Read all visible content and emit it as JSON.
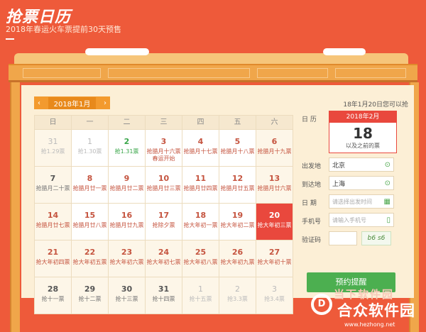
{
  "page": {
    "title": "抢票日历",
    "subtitle": "2018年春运火车票提前30天预售"
  },
  "calendar": {
    "prev": "‹",
    "next": "›",
    "month_label": "2018年1月",
    "weekdays": [
      "日",
      "一",
      "二",
      "三",
      "四",
      "五",
      "六"
    ],
    "rows": [
      [
        {
          "d": "31",
          "n": "抢1.29票",
          "s": "g"
        },
        {
          "d": "1",
          "n": "抢1.30票",
          "s": "gw"
        },
        {
          "d": "2",
          "n": "抢1.31票",
          "s": "grw"
        },
        {
          "d": "3",
          "n": "抢腊月十六票 春运开始",
          "s": "w"
        },
        {
          "d": "4",
          "n": "抢腊月十七票",
          "s": "w"
        },
        {
          "d": "5",
          "n": "抢腊月十八票",
          "s": "w"
        },
        {
          "d": "6",
          "n": "抢腊月十九票",
          "s": ""
        }
      ],
      [
        {
          "d": "7",
          "n": "抢腊月二十票",
          "s": "dk"
        },
        {
          "d": "8",
          "n": "抢腊月廿一票",
          "s": "w"
        },
        {
          "d": "9",
          "n": "抢腊月廿二票",
          "s": "w"
        },
        {
          "d": "10",
          "n": "抢腊月廿三票",
          "s": "w"
        },
        {
          "d": "11",
          "n": "抢腊月廿四票",
          "s": "w"
        },
        {
          "d": "12",
          "n": "抢腊月廿五票",
          "s": "w"
        },
        {
          "d": "13",
          "n": "抢腊月廿六票",
          "s": ""
        }
      ],
      [
        {
          "d": "14",
          "n": "抢腊月廿七票",
          "s": ""
        },
        {
          "d": "15",
          "n": "抢腊月廿八票",
          "s": "w"
        },
        {
          "d": "16",
          "n": "抢腊月廿九票",
          "s": "w"
        },
        {
          "d": "17",
          "n": "抢除夕票",
          "s": "w"
        },
        {
          "d": "18",
          "n": "抢大年初一票",
          "s": "w"
        },
        {
          "d": "19",
          "n": "抢大年初二票",
          "s": "w"
        },
        {
          "d": "20",
          "n": "抢大年初三票",
          "s": "sel"
        }
      ],
      [
        {
          "d": "21",
          "n": "抢大年初四票",
          "s": ""
        },
        {
          "d": "22",
          "n": "抢大年初五票",
          "s": ""
        },
        {
          "d": "23",
          "n": "抢大年初六票",
          "s": ""
        },
        {
          "d": "24",
          "n": "抢大年初七票",
          "s": ""
        },
        {
          "d": "25",
          "n": "抢大年初八票",
          "s": ""
        },
        {
          "d": "26",
          "n": "抢大年初九票",
          "s": ""
        },
        {
          "d": "27",
          "n": "抢大年初十票",
          "s": ""
        }
      ],
      [
        {
          "d": "28",
          "n": "抢十一票",
          "s": "dk"
        },
        {
          "d": "29",
          "n": "抢十二票",
          "s": "dk"
        },
        {
          "d": "30",
          "n": "抢十三票",
          "s": "dk"
        },
        {
          "d": "31",
          "n": "抢十四票",
          "s": "dk"
        },
        {
          "d": "1",
          "n": "抢十五票",
          "s": "g"
        },
        {
          "d": "2",
          "n": "抢3.3票",
          "s": "g"
        },
        {
          "d": "3",
          "n": "抢3.4票",
          "s": "g"
        }
      ]
    ]
  },
  "form": {
    "notice": "18年1月20日您可以抢",
    "date_label": "日  历",
    "date_month": "2018年2月",
    "date_day": "18",
    "date_note": "以及之前的票",
    "from_label": "出发地",
    "from_value": "北京",
    "to_label": "到达地",
    "to_value": "上海",
    "day_label": "日  期",
    "day_placeholder": "请选择出发时间",
    "phone_label": "手机号",
    "phone_placeholder": "请输入手机号",
    "code_label": "验证码",
    "captcha_text": "b6 s6",
    "remind_button": "预约提醒"
  },
  "watermark": {
    "line1": "当下软件园",
    "line2": "合众软件园",
    "url": "www.hezhong.net"
  },
  "icons": {
    "pin": "location-pin-icon",
    "calendar": "calendar-icon",
    "phone": "phone-icon"
  },
  "colors": {
    "background": "#ee5a3a",
    "accent_red": "#e9483d",
    "orange": "#f39a2e",
    "green": "#4caf50"
  }
}
